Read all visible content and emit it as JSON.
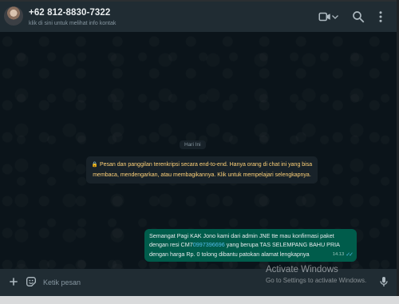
{
  "header": {
    "contact_name": "+62 812-8830-7322",
    "contact_subtitle": "klik di sini untuk melihat info kontak",
    "icons": [
      "video-call-icon",
      "chevron-down-icon",
      "search-icon",
      "menu-icon"
    ]
  },
  "chat": {
    "date_label": "Hari Ini",
    "encryption_notice": "Pesan dan panggilan terenkripsi secara end-to-end. Hanya orang di chat ini yang bisa membaca, mendengarkan, atau membagikannya. Klik untuk mempelajari selengkapnya.",
    "message": {
      "text_before": "Semangat Pagi KAK Jono kami dari admin JNE tte mau konfirmasi paket dengan resi CM7",
      "resi_number": "0997396696",
      "text_after": " yang berupa TAS SELEMPANG BAHU PRIA dengan harga Rp. 0 tolong dibantu patokan alamat lengkapnya",
      "time": "14.13",
      "status": "read"
    }
  },
  "footer": {
    "input_placeholder": "Ketik pesan",
    "icons": [
      "plus-icon",
      "sticker-icon",
      "microphone-icon"
    ]
  },
  "watermark": {
    "line1": "Activate Windows",
    "line2": "Go to Settings to activate Windows."
  },
  "colors": {
    "header_bg": "#202c33",
    "chat_bg": "#0b141a",
    "outgoing_bubble": "#005c4b",
    "notice_text": "#ffd279",
    "link_blue": "#53bdeb"
  }
}
